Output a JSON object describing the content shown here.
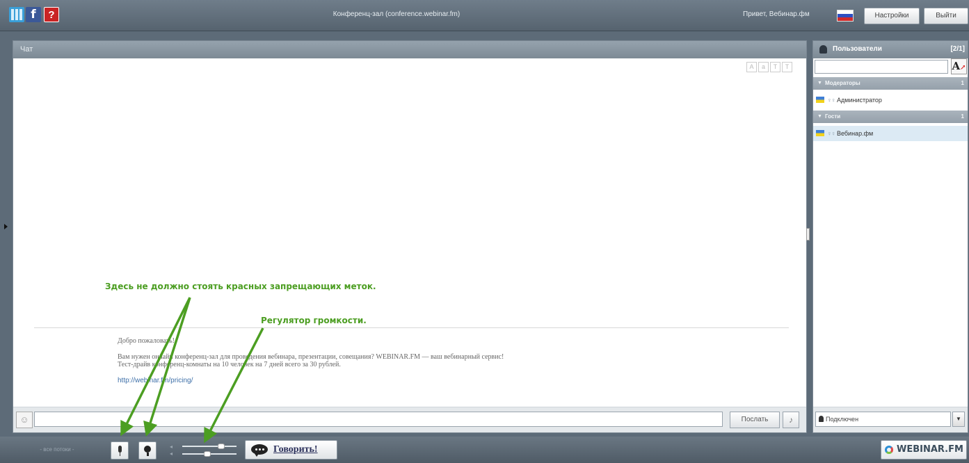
{
  "topbar": {
    "room_title": "Конференц-зал (conference.webinar.fm)",
    "greeting": "Привет, Вебинар.фм",
    "settings_label": "Настройки",
    "exit_label": "Выйти",
    "icons": [
      "grid-icon",
      "facebook-icon",
      "help-icon",
      "russian-flag-icon"
    ],
    "help_glyph": "?",
    "fb_glyph": "f"
  },
  "chat": {
    "title": "Чат",
    "welcome_title": "Добро пожаловать!",
    "welcome_line1": "Вам нужен онлайн конференц-зал для проведения вебинара, презентации, совещания? WEBINAR.FM — ваш вебинарный сервис!",
    "welcome_line2": "Тест-драйв конференц-комнаты на 10 человек на 7 дней всего за 30 рублей.",
    "welcome_link": "http://webinar.fm/pricing/",
    "input_value": "",
    "send_label": "Послать"
  },
  "users": {
    "title": "Пользователи",
    "count": "[2/1]",
    "search_value": "",
    "groups": [
      {
        "name": "Модераторы",
        "count": "1",
        "users": [
          "Администратор"
        ]
      },
      {
        "name": "Гости",
        "count": "1",
        "users": [
          "Вебинар.фм"
        ]
      }
    ],
    "status_label": "Подключен"
  },
  "bottombar": {
    "camera_placeholder": "- все потоки -",
    "speak_label": "Говорить!",
    "brand": "WEBINAR.FM",
    "volume_level": 0.7,
    "mic_level": 0.45
  },
  "annotations": {
    "no_red_marks": "Здесь не должно стоять красных запрещающих меток.",
    "volume_control": "Регулятор громкости."
  },
  "colors": {
    "annotation_green": "#4c9e22",
    "top_bar": "#5d6b78",
    "selected_user": "#dceaf4"
  }
}
